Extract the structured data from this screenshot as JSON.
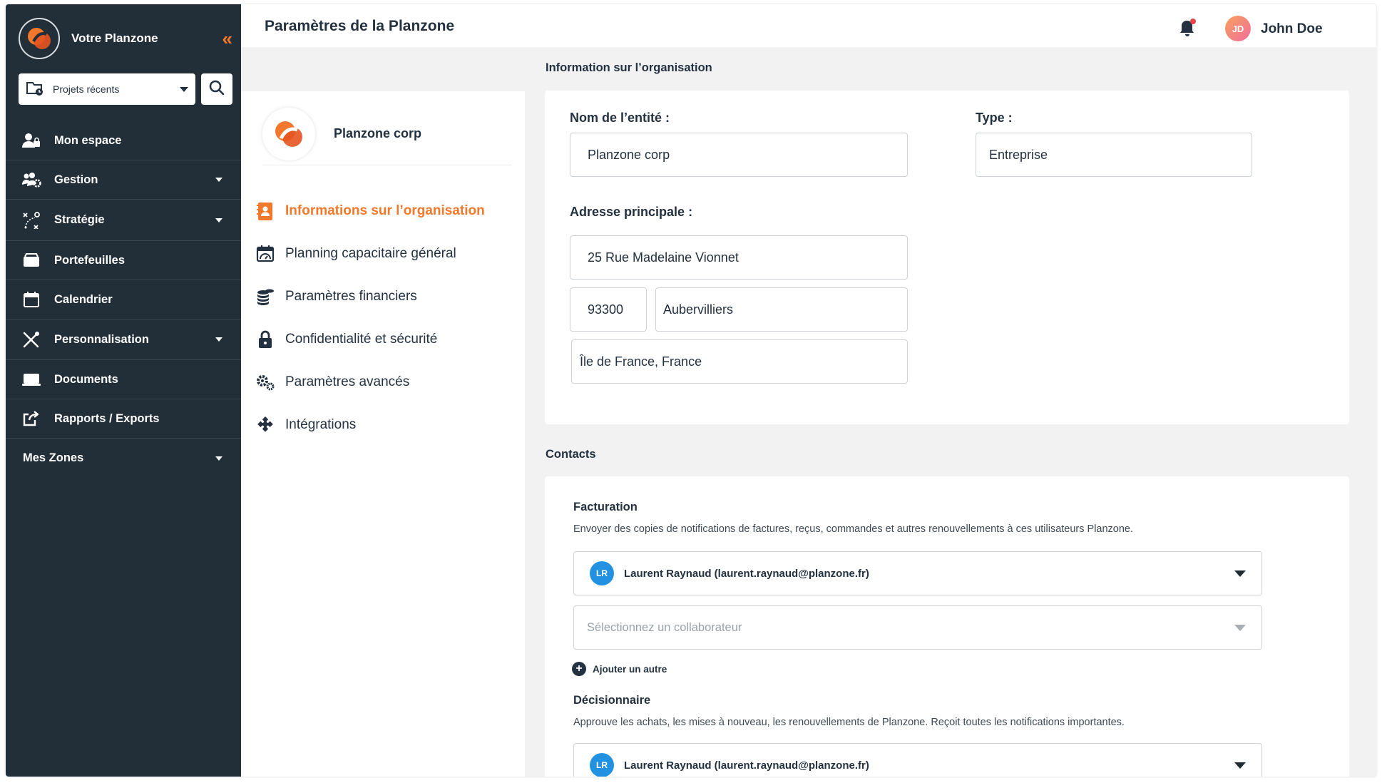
{
  "sidebar": {
    "brand_name": "Votre Planzone",
    "recent_projects": "Projets récents",
    "items": [
      {
        "label": "Mon espace"
      },
      {
        "label": "Gestion"
      },
      {
        "label": "Stratégie"
      },
      {
        "label": "Portefeuilles"
      },
      {
        "label": "Calendrier"
      },
      {
        "label": "Personnalisation"
      },
      {
        "label": "Documents"
      },
      {
        "label": "Rapports / Exports"
      },
      {
        "label": "Mes Zones"
      }
    ]
  },
  "header": {
    "title": "Paramètres de la Planzone",
    "user_initials": "JD",
    "user_name": "John Doe"
  },
  "settings_nav": {
    "org_name": "Planzone corp",
    "items": [
      {
        "label": "Informations sur l’organisation",
        "active": true
      },
      {
        "label": "Planning capacitaire général"
      },
      {
        "label": "Paramètres financiers"
      },
      {
        "label": "Confidentialité et sécurité"
      },
      {
        "label": "Paramètres avancés"
      },
      {
        "label": "Intégrations"
      }
    ]
  },
  "org_info": {
    "section_title": "Information sur l’organisation",
    "entity_label": "Nom de l’entité :",
    "entity_value": "Planzone corp",
    "type_label": "Type :",
    "type_value": "Entreprise",
    "address_label": "Adresse principale :",
    "street": "25 Rue Madelaine Vionnet",
    "postal_code": "93300",
    "city": "Aubervilliers",
    "region": "Île de France, France"
  },
  "contacts": {
    "section_title": "Contacts",
    "billing": {
      "title": "Facturation",
      "description": "Envoyer des copies de notifications de factures, reçus, commandes et autres renouvellements à ces utilisateurs Planzone.",
      "selected_initials": "LR",
      "selected_user": "Laurent Raynaud (laurent.raynaud@planzone.fr)",
      "placeholder": "Sélectionnez un collaborateur",
      "add_another": "Ajouter un autre"
    },
    "decision": {
      "title": "Décisionnaire",
      "description": "Approuve les achats, les mises à nouveau, les renouvellements de Planzone. Reçoit toutes les notifications importantes.",
      "selected_initials": "LR",
      "selected_user": "Laurent Raynaud (laurent.raynaud@planzone.fr)"
    }
  },
  "colors": {
    "sidebar_bg": "#232f38",
    "accent": "#f2792b",
    "avatar_blue": "#2291e2",
    "notification_dot": "#e8434b"
  }
}
